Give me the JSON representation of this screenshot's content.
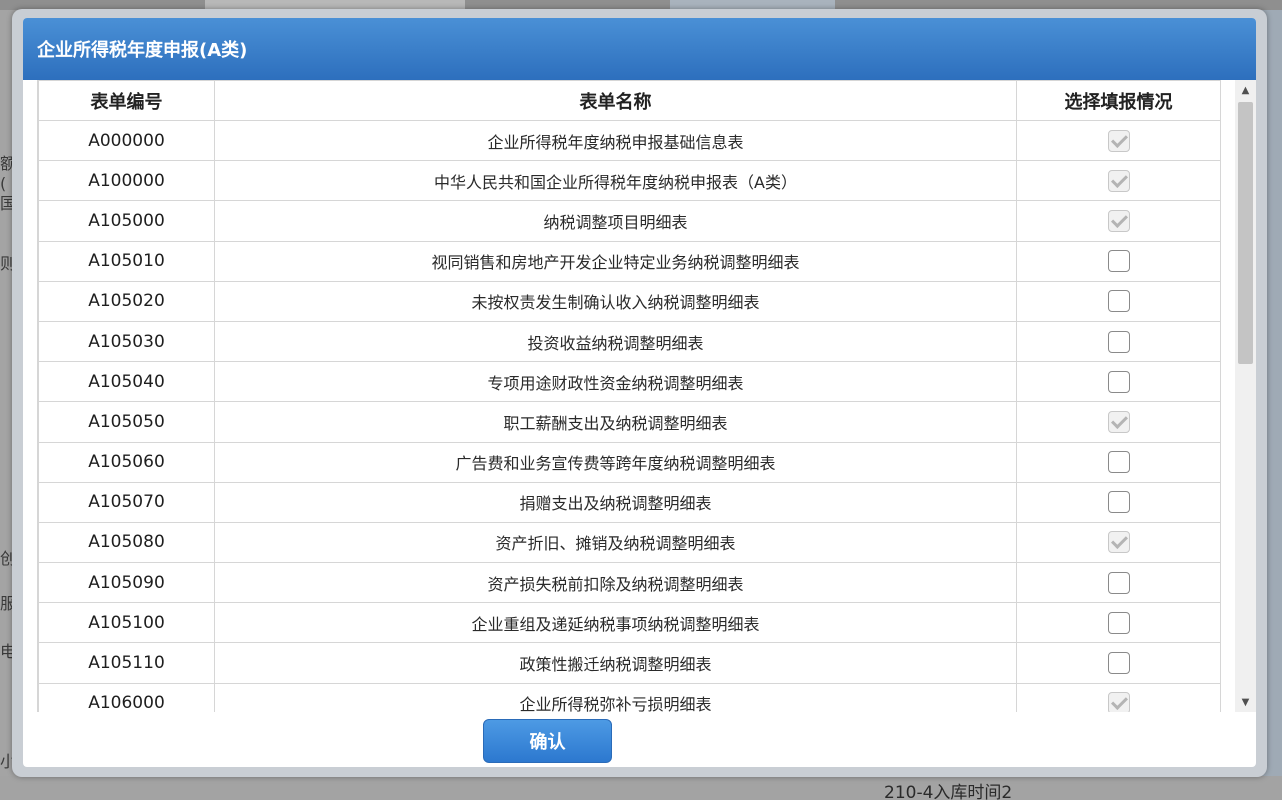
{
  "dialog": {
    "title": "企业所得税年度申报(A类)",
    "confirm_label": "确认"
  },
  "table": {
    "headers": [
      "表单编号",
      "表单名称",
      "选择填报情况"
    ],
    "rows": [
      {
        "code": "A000000",
        "name": "企业所得税年度纳税申报基础信息表",
        "checked": true,
        "disabled": true
      },
      {
        "code": "A100000",
        "name": "中华人民共和国企业所得税年度纳税申报表（A类）",
        "checked": true,
        "disabled": true
      },
      {
        "code": "A105000",
        "name": "纳税调整项目明细表",
        "checked": true,
        "disabled": true
      },
      {
        "code": "A105010",
        "name": "视同销售和房地产开发企业特定业务纳税调整明细表",
        "checked": false,
        "disabled": false
      },
      {
        "code": "A105020",
        "name": "未按权责发生制确认收入纳税调整明细表",
        "checked": false,
        "disabled": false
      },
      {
        "code": "A105030",
        "name": "投资收益纳税调整明细表",
        "checked": false,
        "disabled": false
      },
      {
        "code": "A105040",
        "name": "专项用途财政性资金纳税调整明细表",
        "checked": false,
        "disabled": false
      },
      {
        "code": "A105050",
        "name": "职工薪酬支出及纳税调整明细表",
        "checked": true,
        "disabled": true
      },
      {
        "code": "A105060",
        "name": "广告费和业务宣传费等跨年度纳税调整明细表",
        "checked": false,
        "disabled": false
      },
      {
        "code": "A105070",
        "name": "捐赠支出及纳税调整明细表",
        "checked": false,
        "disabled": false
      },
      {
        "code": "A105080",
        "name": "资产折旧、摊销及纳税调整明细表",
        "checked": true,
        "disabled": true
      },
      {
        "code": "A105090",
        "name": "资产损失税前扣除及纳税调整明细表",
        "checked": false,
        "disabled": false
      },
      {
        "code": "A105100",
        "name": "企业重组及递延纳税事项纳税调整明细表",
        "checked": false,
        "disabled": false
      },
      {
        "code": "A105110",
        "name": "政策性搬迁纳税调整明细表",
        "checked": false,
        "disabled": false
      },
      {
        "code": "A106000",
        "name": "企业所得税弥补亏损明细表",
        "checked": true,
        "disabled": true
      }
    ]
  },
  "background": {
    "left_chars": [
      "额(",
      "国",
      "则",
      "创",
      "服",
      "电",
      "小"
    ],
    "bottom_text": "210-4入库时间2"
  },
  "icons": {
    "scroll_up": "scroll-up-arrow-icon",
    "scroll_down": "scroll-down-arrow-icon",
    "checkbox": "checkbox-icon"
  },
  "colors": {
    "title_bar": "#3a7fcb",
    "confirm_button": "#3a87db",
    "checkbox_disabled": "#b4b4b4"
  }
}
